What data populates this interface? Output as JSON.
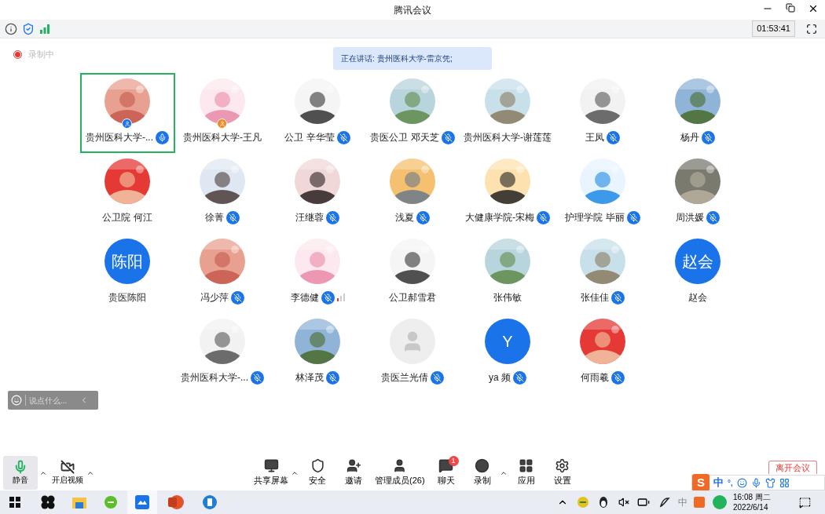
{
  "window": {
    "title": "腾讯会议"
  },
  "timer": "01:53:41",
  "recording": {
    "label": "录制中",
    "on": true
  },
  "speaking_banner": "正在讲话: 贵州医科大学-雷京凭;",
  "participants": [
    [
      {
        "name": "贵州医科大学-...",
        "kind": "picture",
        "mic": {
          "muted": false
        },
        "host": true,
        "cohost": false,
        "selected": true
      },
      {
        "name": "贵州医科大学-王凡",
        "kind": "picture",
        "host": false,
        "cohost": true,
        "selected": false
      },
      {
        "name": "公卫 辛华莹",
        "kind": "picture",
        "mic": {
          "muted": true
        },
        "host": false,
        "cohost": false,
        "selected": false
      },
      {
        "name": "贵医公卫 邓天芝",
        "kind": "picture",
        "mic": {
          "muted": true
        },
        "host": false,
        "cohost": false,
        "selected": false
      },
      {
        "name": "贵州医科大学-谢莲莲",
        "kind": "picture",
        "host": false,
        "cohost": false,
        "selected": false
      },
      {
        "name": "王凤",
        "kind": "picture",
        "mic": {
          "muted": true
        },
        "host": false,
        "cohost": false,
        "selected": false
      },
      {
        "name": "杨丹",
        "kind": "picture",
        "mic": {
          "muted": true
        },
        "host": false,
        "cohost": false,
        "selected": false
      }
    ],
    [
      {
        "name": "公卫院 何江",
        "kind": "picture",
        "host": false,
        "cohost": false,
        "selected": false
      },
      {
        "name": "徐菁",
        "kind": "picture",
        "mic": {
          "muted": true
        },
        "host": false,
        "cohost": false,
        "selected": false
      },
      {
        "name": "汪继蓉",
        "kind": "picture",
        "mic": {
          "muted": true
        },
        "host": false,
        "cohost": false,
        "selected": false
      },
      {
        "name": "浅夏",
        "kind": "picture",
        "mic": {
          "muted": true
        },
        "host": false,
        "cohost": false,
        "selected": false
      },
      {
        "name": "大健康学院-宋梅",
        "kind": "picture",
        "mic": {
          "muted": true
        },
        "host": false,
        "cohost": false,
        "selected": false
      },
      {
        "name": "护理学院 毕丽",
        "kind": "picture",
        "mic": {
          "muted": true
        },
        "host": false,
        "cohost": false,
        "selected": false
      },
      {
        "name": "周洪媛",
        "kind": "picture",
        "mic": {
          "muted": true
        },
        "host": false,
        "cohost": false,
        "selected": false
      }
    ],
    [
      {
        "name": "贵医陈阳",
        "kind": "initials",
        "initials": "陈阳",
        "host": false,
        "cohost": false,
        "selected": false
      },
      {
        "name": "冯少萍",
        "kind": "picture",
        "mic": {
          "muted": true
        },
        "host": false,
        "cohost": false,
        "selected": false
      },
      {
        "name": "李德健",
        "kind": "picture",
        "mic": {
          "muted": true
        },
        "host": false,
        "cohost": false,
        "selected": false,
        "weak_signal": true
      },
      {
        "name": "公卫郝雪君",
        "kind": "picture",
        "host": false,
        "cohost": false,
        "selected": false
      },
      {
        "name": "张伟敏",
        "kind": "picture",
        "host": false,
        "cohost": false,
        "selected": false
      },
      {
        "name": "张佳佳",
        "kind": "picture",
        "mic": {
          "muted": true
        },
        "host": false,
        "cohost": false,
        "selected": false
      },
      {
        "name": "赵会",
        "kind": "initials",
        "initials": "赵会",
        "host": false,
        "cohost": false,
        "selected": false
      }
    ],
    [
      {
        "name": "贵州医科大学-...",
        "kind": "picture",
        "mic": {
          "muted": true
        },
        "host": false,
        "cohost": false,
        "selected": false
      },
      {
        "name": "林泽茂",
        "kind": "picture",
        "mic": {
          "muted": true
        },
        "host": false,
        "cohost": false,
        "selected": false
      },
      {
        "name": "贵医兰光倩",
        "kind": "default",
        "mic": {
          "muted": true
        },
        "host": false,
        "cohost": false,
        "selected": false
      },
      {
        "name": "ya 频",
        "kind": "initials",
        "initials": "Y",
        "mic": {
          "muted": true
        },
        "host": false,
        "cohost": false,
        "selected": false
      },
      {
        "name": "何雨羲",
        "kind": "picture",
        "mic": {
          "muted": true
        },
        "host": false,
        "cohost": false,
        "selected": false
      }
    ]
  ],
  "chat_input": {
    "placeholder": "说点什么..."
  },
  "toolbar": {
    "left": [
      {
        "kind": "mic",
        "label": "静音",
        "selected": true
      },
      {
        "kind": "camera",
        "label": "开启视频",
        "selected": false
      }
    ],
    "center": [
      {
        "kind": "share",
        "label": "共享屏幕",
        "caret": true
      },
      {
        "kind": "security",
        "label": "安全",
        "caret": false
      },
      {
        "kind": "invite",
        "label": "邀请",
        "caret": false
      },
      {
        "kind": "members",
        "label": "管理成员(26)",
        "caret": false
      },
      {
        "kind": "chat",
        "label": "聊天",
        "caret": false,
        "badge": "1"
      },
      {
        "kind": "record",
        "label": "录制",
        "caret": true
      },
      {
        "kind": "apps",
        "label": "应用",
        "caret": false
      },
      {
        "kind": "settings",
        "label": "设置",
        "caret": false
      }
    ],
    "leave_button": "离开会议"
  },
  "ime_bar": {
    "logo": "S",
    "mode": "中",
    "punct": "°,"
  },
  "taskbar": {
    "tray_ime": "中",
    "time": "16:08 周二",
    "date": "2022/6/14"
  }
}
